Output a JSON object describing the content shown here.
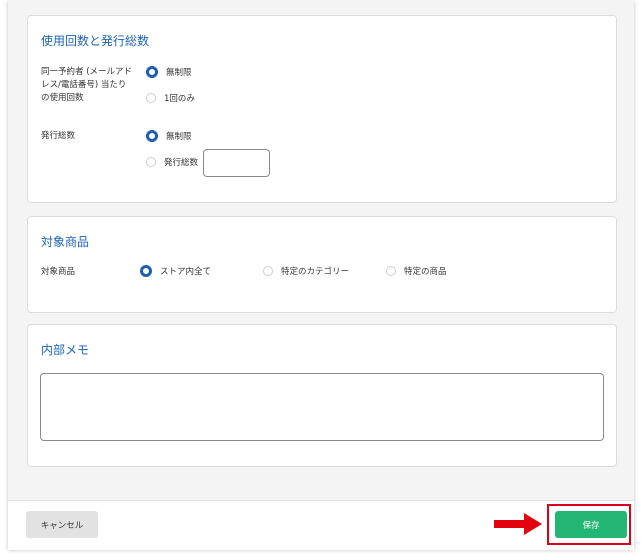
{
  "usage": {
    "title": "使用回数と発行総数",
    "per_customer_label_lines": [
      "同一予約者 (メールアド",
      "レス/電話番号) 当たり",
      "の使用回数"
    ],
    "per_customer_options": [
      "無制限",
      "1回のみ"
    ],
    "total_label": "発行総数",
    "total_options": [
      "無制限",
      "発行総数"
    ],
    "total_input_value": ""
  },
  "target": {
    "title": "対象商品",
    "label": "対象商品",
    "options": [
      "ストア内全て",
      "特定のカテゴリー",
      "特定の商品"
    ]
  },
  "memo": {
    "title": "内部メモ",
    "value": ""
  },
  "footer": {
    "cancel_label": "キャンセル",
    "save_label": "保存"
  },
  "colors": {
    "accent": "#1c64b4",
    "save": "#22b573",
    "highlight": "#d9001b"
  }
}
